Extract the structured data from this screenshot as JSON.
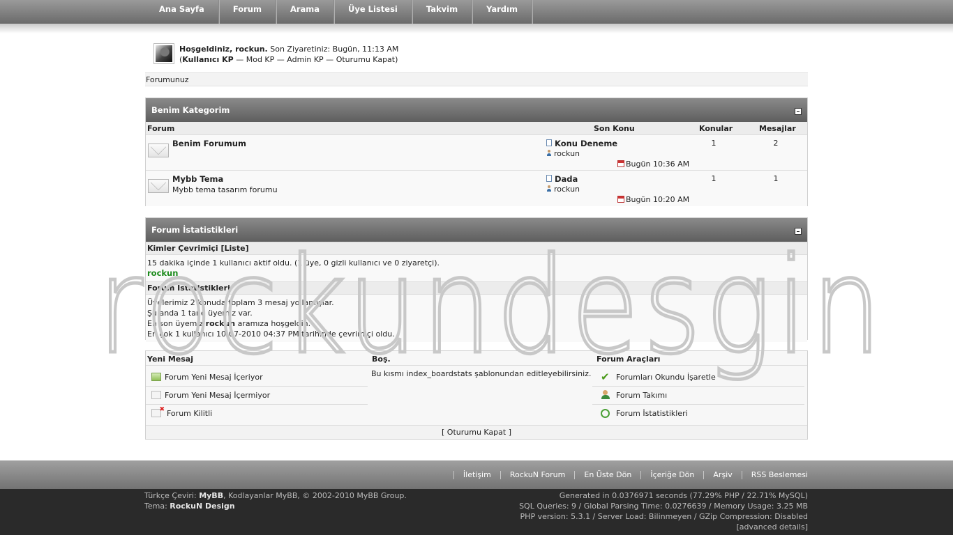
{
  "nav": {
    "items": [
      "Ana Sayfa",
      "Forum",
      "Arama",
      "Üye Listesi",
      "Takvim",
      "Yardım"
    ]
  },
  "welcome": {
    "greeting": "Hoşgeldiniz, rockun.",
    "last_visit": "Son Ziyaretiniz: Bugün, 11:13 AM",
    "open_paren": "(",
    "user_cp": "Kullanıcı KP",
    "sep1": " — ",
    "mod_cp": "Mod KP",
    "sep2": " — ",
    "admin_cp": "Admin KP",
    "sep3": " — ",
    "logout": "Oturumu Kapat",
    "close_paren": ")"
  },
  "breadcrumb": "Forumunuz",
  "category": {
    "title": "Benim Kategorim",
    "columns": {
      "forum": "Forum",
      "last_post": "Son Konu",
      "threads": "Konular",
      "posts": "Mesajlar"
    },
    "forums": [
      {
        "name": "Benim Forumum",
        "description": "",
        "last_subject": "Konu Deneme",
        "last_user": "rockun",
        "last_date": "Bugün 10:36 AM",
        "threads": "1",
        "posts": "2"
      },
      {
        "name": "Mybb Tema",
        "description": "Mybb tema tasarım forumu",
        "last_subject": "Dada",
        "last_user": "rockun",
        "last_date": "Bugün 10:20 AM",
        "threads": "1",
        "posts": "1"
      }
    ]
  },
  "stats": {
    "title": "Forum İstatistikleri",
    "online_head": "Kimler Çevrimiçi",
    "online_list_open": " [",
    "online_list": "Liste",
    "online_list_close": "]",
    "online_text": "15 dakika içinde 1 kullanıcı aktif oldu. (1 üye, 0 gizli kullanıcı ve 0 ziyaretçi).",
    "online_user": "rockun",
    "stats_head": "Forum İstatistikleri",
    "line1": "Üyelerimiz 2 konuda toplam 3 mesaj yollamışlar.",
    "line2": "Şu anda 1 tane üyemiz var.",
    "line3_pre": "En son üyemiz ",
    "line3_user": "rockun",
    "line3_post": " aramıza hoşgeldin.",
    "line4": "En çok 1 kullanıcı 10-07-2010 04:37 PM tarihinde çevrimiçi oldu."
  },
  "legend": {
    "col1_title": "Yeni Mesaj",
    "col1_items": [
      "Forum Yeni Mesaj İçeriyor",
      "Forum Yeni Mesaj İçermiyor",
      "Forum Kilitli"
    ],
    "col2_title": "Boş.",
    "col2_text": "Bu kısmı index_boardstats şablonundan editleyebilirsiniz.",
    "col3_title": "Forum Araçları",
    "col3_items": [
      "Forumları Okundu İşaretle",
      "Forum Takımı",
      "Forum İstatistikleri"
    ],
    "footer": "[ Oturumu Kapat ]"
  },
  "watermark": "rockundesgin",
  "footer": {
    "links": [
      "İletişim",
      "RockuN Forum",
      "En Üste Dön",
      "İçeriğe Dön",
      "Arşiv",
      "RSS Beslemesi"
    ],
    "copy1_pre": "Türkçe Çeviri: ",
    "copy1_mybb": "MyBB",
    "copy1_post": ", Kodlayanlar MyBB, © 2002-2010 MyBB Group.",
    "copy2_pre": "Tema: ",
    "copy2_theme": "RockuN Design",
    "debug1": "Generated in 0.0376971 seconds (77.29% PHP / 22.71% MySQL)",
    "debug2": "SQL Queries: 9 / Global Parsing Time: 0.0276639 / Memory Usage: 3.25 MB",
    "debug3": "PHP version: 5.3.1 / Server Load: Bilinmeyen / GZip Compression: Disabled",
    "debug4": "[advanced details]"
  }
}
